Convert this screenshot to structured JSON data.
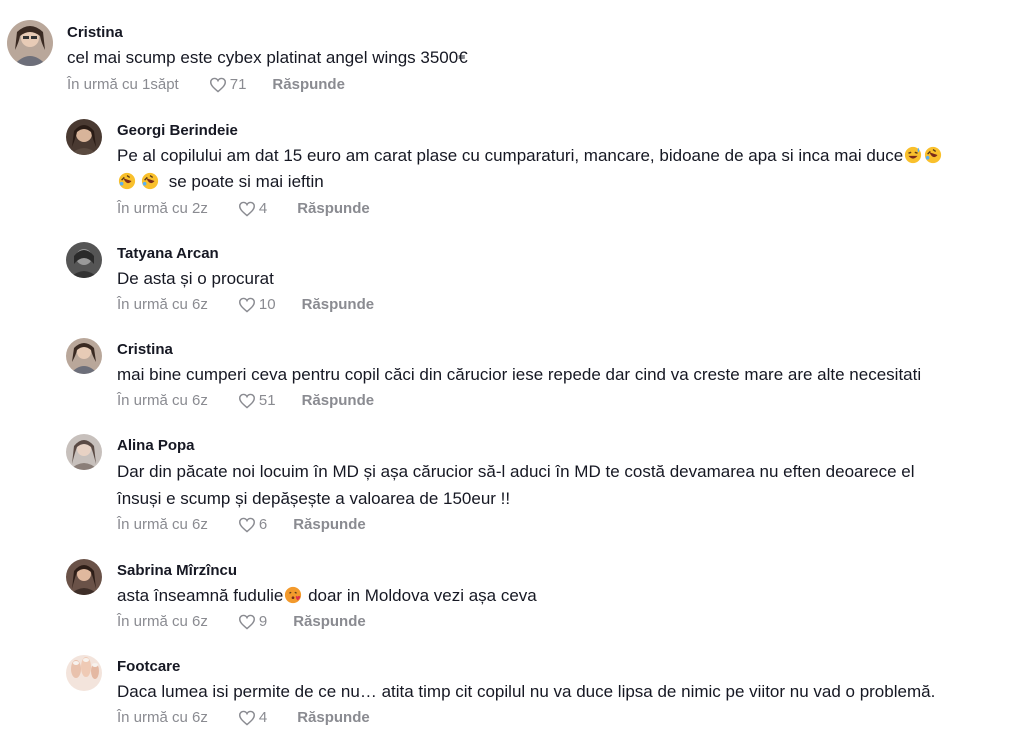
{
  "comments": [
    {
      "username": "Cristina",
      "text": "cel mai scump este cybex platinat angel wings 3500€",
      "time": "În urmă cu 1săpt",
      "likes": "71",
      "reply": "Răspunde"
    },
    {
      "username": "Georgi Berindeie",
      "text_line1": "Pe al copilului am dat 15 euro am carat plase cu cumparaturi, mancare, bidoane de apa si inca mai duce",
      "text_line2": "se poate si mai ieftin",
      "emoji_line1": [
        "grinning-sweat-emoji",
        "rolling-laughing-emoji"
      ],
      "emoji_line2": [
        "rolling-laughing-emoji",
        "rolling-laughing-emoji"
      ],
      "time": "În urmă cu 2z",
      "likes": "4",
      "reply": "Răspunde"
    },
    {
      "username": "Tatyana Arcan",
      "text": "De asta și o procurat",
      "time": "În urmă cu 6z",
      "likes": "10",
      "reply": "Răspunde"
    },
    {
      "username": "Cristina",
      "text": "mai bine cumperi ceva pentru copil căci din cărucior iese repede dar cind va creste mare are alte necesitati",
      "time": "În urmă cu 6z",
      "likes": "51",
      "reply": "Răspunde"
    },
    {
      "username": "Alina Popa",
      "text_line1": "Dar din păcate noi locuim în MD și așa cărucior să-l aduci în MD te costă devamarea nu eften deoarece el",
      "text_line2": "însuși e scump și depășește a valoarea de 150eur !!",
      "time": "În urmă cu 6z",
      "likes": "6",
      "reply": "Răspunde"
    },
    {
      "username": "Sabrina Mîrzîncu",
      "text_before_emoji": "asta înseamnă fudulie",
      "text_after_emoji": " doar in Moldova vezi așa ceva",
      "emoji": "face-blowing-kiss-emoji",
      "time": "În urmă cu 6z",
      "likes": "9",
      "reply": "Răspunde"
    },
    {
      "username": "Footcare",
      "text": "Daca lumea isi permite de ce nu… atita timp cit copilul nu va duce lipsa de nimic pe viitor nu vad o problemă.",
      "time": "În urmă cu 6z",
      "likes": "4",
      "reply": "Răspunde"
    }
  ]
}
